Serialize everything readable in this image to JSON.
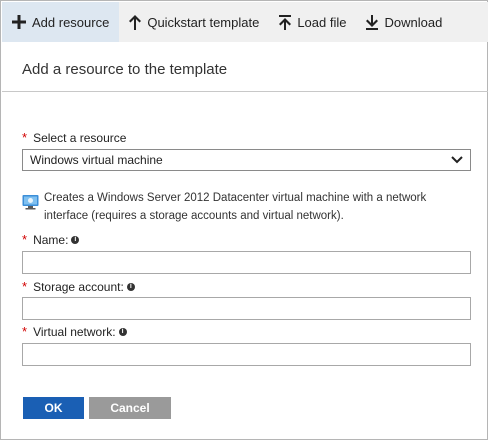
{
  "toolbar": {
    "items": [
      {
        "label": "Add resource",
        "icon": "plus-icon",
        "active": true
      },
      {
        "label": "Quickstart template",
        "icon": "arrow-up-icon"
      },
      {
        "label": "Load file",
        "icon": "upload-icon"
      },
      {
        "label": "Download",
        "icon": "download-icon"
      }
    ]
  },
  "panel": {
    "title": "Add a resource to the template"
  },
  "form": {
    "required_marker": "*",
    "resource_label": "Select a resource",
    "resource_value": "Windows virtual machine",
    "description": "Creates a Windows Server 2012 Datacenter virtual machine with a network interface (requires a storage accounts and virtual network).",
    "name_label": "Name:",
    "storage_label": "Storage account:",
    "network_label": "Virtual network:",
    "name_value": "",
    "storage_value": "",
    "network_value": ""
  },
  "buttons": {
    "ok_label": "OK",
    "cancel_label": "Cancel"
  },
  "colors": {
    "primary": "#1a5fb4",
    "required": "#d10000",
    "toolbar_bg": "#f0f0f0",
    "active_tab_bg": "#dde7f1"
  }
}
